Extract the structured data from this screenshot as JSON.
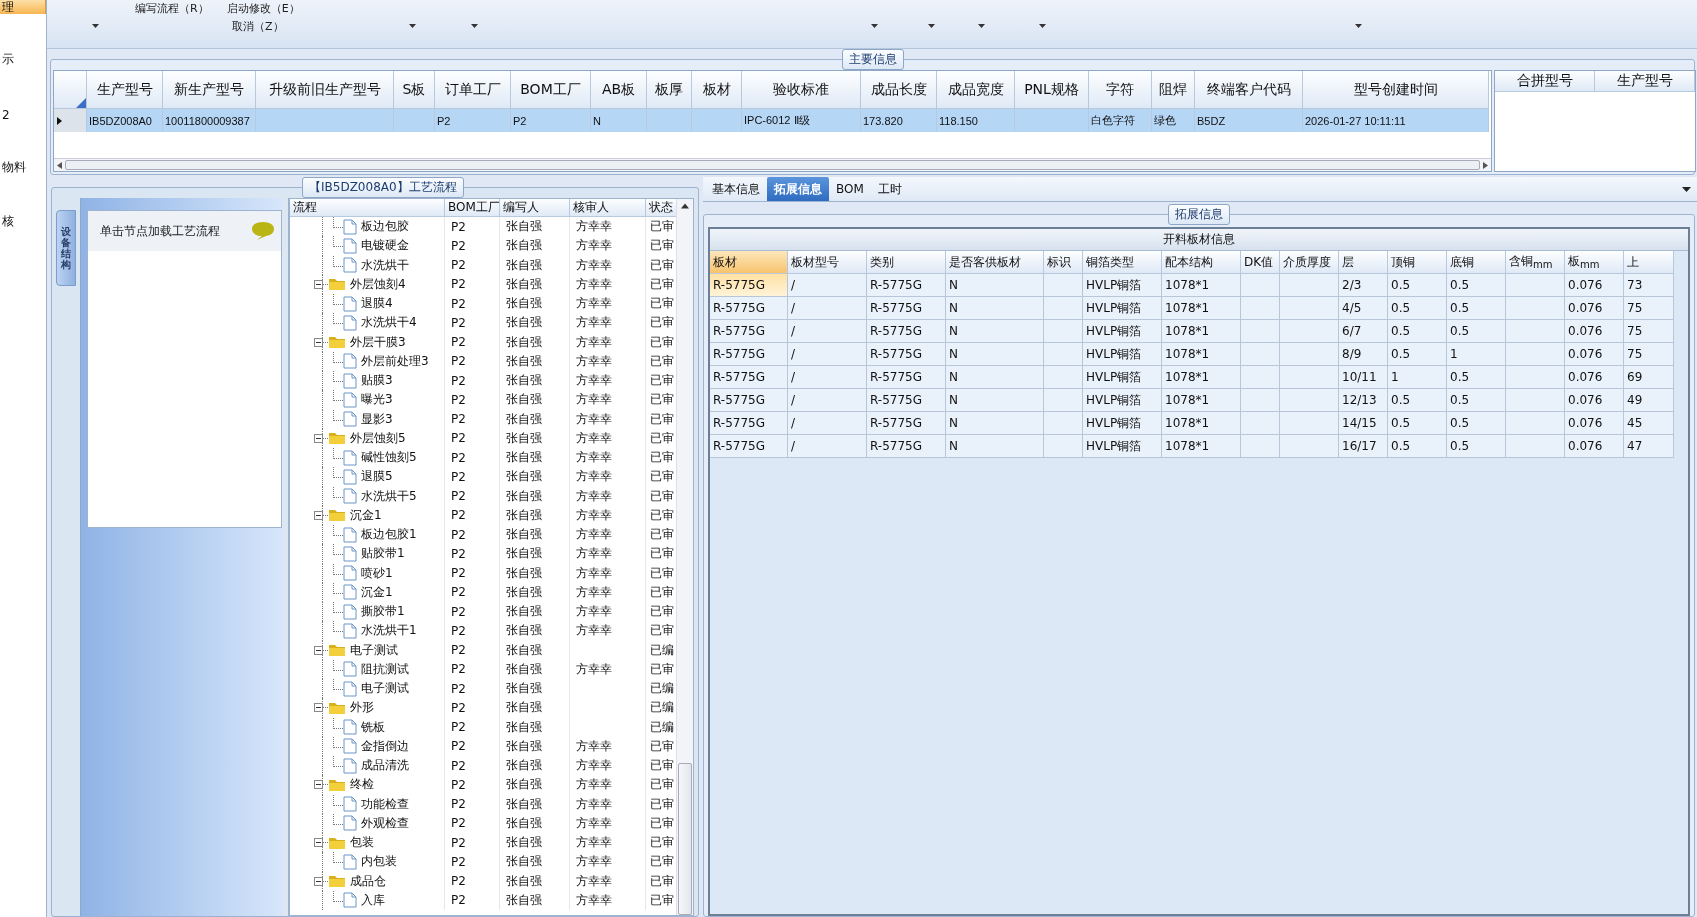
{
  "side_menu": [
    {
      "label": "理",
      "selected": true
    },
    {
      "label": "示",
      "selected": false
    },
    {
      "label": "2",
      "selected": false
    },
    {
      "label": "物料",
      "selected": false
    },
    {
      "label": "核",
      "selected": false
    }
  ],
  "toolbar": {
    "buttons": [
      "编写流程（R）",
      "启动修改（E）"
    ],
    "cancel": "取消（Z）"
  },
  "main_info": {
    "title": "主要信息",
    "columns": [
      "生产型号",
      "新生产型号",
      "升级前旧生产型号",
      "S板",
      "订单工厂",
      "BOM工厂",
      "AB板",
      "板厚",
      "板材",
      "验收标准",
      "成品长度",
      "成品宽度",
      "PNL规格",
      "字符",
      "阻焊",
      "终端客户代码",
      "型号创建时间"
    ],
    "rows": [
      {
        "selected": true,
        "cells": [
          "IB5DZ008A0",
          "10011800009387",
          null,
          null,
          "P2",
          "P2",
          "N",
          null,
          null,
          "IPC-6012 Ⅱ级",
          "173.820",
          "118.150",
          null,
          "白色字符",
          "绿色",
          "B5DZ",
          "2026-01-27 10:11:11"
        ]
      }
    ],
    "merge_table": {
      "columns": [
        "合拼型号",
        "生产型号"
      ]
    }
  },
  "process": {
    "title": "【IB5DZ008A0】工艺流程",
    "side_tab": "设备结构",
    "hint": "单击节点加载工艺流程",
    "tree": {
      "columns": [
        "流程",
        "BOM工厂",
        "编写人",
        "核审人",
        "状态"
      ],
      "continued": [
        {
          "label": "板边包胶",
          "bom": "P2",
          "author": "张自强",
          "reviewer": "方幸幸",
          "status": "已审"
        },
        {
          "label": "电镀硬金",
          "bom": "P2",
          "author": "张自强",
          "reviewer": "方幸幸",
          "status": "已审"
        },
        {
          "label": "水洗烘干",
          "bom": "P2",
          "author": "张自强",
          "reviewer": "方幸幸",
          "status": "已审"
        }
      ],
      "nodes": [
        {
          "label": "外层蚀刻4",
          "bom": "P2",
          "author": "张自强",
          "reviewer": "方幸幸",
          "status": "已审",
          "expanded": true,
          "children": [
            {
              "label": "退膜4",
              "bom": "P2",
              "author": "张自强",
              "reviewer": "方幸幸",
              "status": "已审"
            },
            {
              "label": "水洗烘干4",
              "bom": "P2",
              "author": "张自强",
              "reviewer": "方幸幸",
              "status": "已审"
            }
          ]
        },
        {
          "label": "外层干膜3",
          "bom": "P2",
          "author": "张自强",
          "reviewer": "方幸幸",
          "status": "已审",
          "expanded": true,
          "children": [
            {
              "label": "外层前处理3",
              "bom": "P2",
              "author": "张自强",
              "reviewer": "方幸幸",
              "status": "已审"
            },
            {
              "label": "贴膜3",
              "bom": "P2",
              "author": "张自强",
              "reviewer": "方幸幸",
              "status": "已审"
            },
            {
              "label": "曝光3",
              "bom": "P2",
              "author": "张自强",
              "reviewer": "方幸幸",
              "status": "已审"
            },
            {
              "label": "显影3",
              "bom": "P2",
              "author": "张自强",
              "reviewer": "方幸幸",
              "status": "已审"
            }
          ]
        },
        {
          "label": "外层蚀刻5",
          "bom": "P2",
          "author": "张自强",
          "reviewer": "方幸幸",
          "status": "已审",
          "expanded": true,
          "children": [
            {
              "label": "碱性蚀刻5",
              "bom": "P2",
              "author": "张自强",
              "reviewer": "方幸幸",
              "status": "已审"
            },
            {
              "label": "退膜5",
              "bom": "P2",
              "author": "张自强",
              "reviewer": "方幸幸",
              "status": "已审"
            },
            {
              "label": "水洗烘干5",
              "bom": "P2",
              "author": "张自强",
              "reviewer": "方幸幸",
              "status": "已审"
            }
          ]
        },
        {
          "label": "沉金1",
          "bom": "P2",
          "author": "张自强",
          "reviewer": "方幸幸",
          "status": "已审",
          "expanded": true,
          "children": [
            {
              "label": "板边包胶1",
              "bom": "P2",
              "author": "张自强",
              "reviewer": "方幸幸",
              "status": "已审"
            },
            {
              "label": "贴胶带1",
              "bom": "P2",
              "author": "张自强",
              "reviewer": "方幸幸",
              "status": "已审"
            },
            {
              "label": "喷砂1",
              "bom": "P2",
              "author": "张自强",
              "reviewer": "方幸幸",
              "status": "已审"
            },
            {
              "label": "沉金1",
              "bom": "P2",
              "author": "张自强",
              "reviewer": "方幸幸",
              "status": "已审"
            },
            {
              "label": "撕胶带1",
              "bom": "P2",
              "author": "张自强",
              "reviewer": "方幸幸",
              "status": "已审"
            },
            {
              "label": "水洗烘干1",
              "bom": "P2",
              "author": "张自强",
              "reviewer": "方幸幸",
              "status": "已审"
            }
          ]
        },
        {
          "label": "电子测试",
          "bom": "P2",
          "author": "张自强",
          "status": "已编",
          "expanded": true,
          "children": [
            {
              "label": "阻抗测试",
              "bom": "P2",
              "author": "张自强",
              "reviewer": "方幸幸",
              "status": "已审"
            },
            {
              "label": "电子测试",
              "bom": "P2",
              "author": "张自强",
              "status": "已编"
            }
          ]
        },
        {
          "label": "外形",
          "bom": "P2",
          "author": "张自强",
          "status": "已编",
          "expanded": true,
          "children": [
            {
              "label": "铣板",
              "bom": "P2",
              "author": "张自强",
              "status": "已编"
            },
            {
              "label": "金指倒边",
              "bom": "P2",
              "author": "张自强",
              "reviewer": "方幸幸",
              "status": "已审"
            },
            {
              "label": "成品清洗",
              "bom": "P2",
              "author": "张自强",
              "reviewer": "方幸幸",
              "status": "已审"
            }
          ]
        },
        {
          "label": "终检",
          "bom": "P2",
          "author": "张自强",
          "reviewer": "方幸幸",
          "status": "已审",
          "expanded": true,
          "children": [
            {
              "label": "功能检查",
              "bom": "P2",
              "author": "张自强",
              "reviewer": "方幸幸",
              "status": "已审"
            },
            {
              "label": "外观检查",
              "bom": "P2",
              "author": "张自强",
              "reviewer": "方幸幸",
              "status": "已审"
            }
          ]
        },
        {
          "label": "包装",
          "bom": "P2",
          "author": "张自强",
          "reviewer": "方幸幸",
          "status": "已审",
          "expanded": true,
          "children": [
            {
              "label": "内包装",
              "bom": "P2",
              "author": "张自强",
              "reviewer": "方幸幸",
              "status": "已审"
            }
          ]
        },
        {
          "label": "成品仓",
          "bom": "P2",
          "author": "张自强",
          "reviewer": "方幸幸",
          "status": "已审",
          "expanded": true,
          "children": [
            {
              "label": "入库",
              "bom": "P2",
              "author": "张自强",
              "reviewer": "方幸幸",
              "status": "已审"
            }
          ]
        }
      ]
    }
  },
  "detail": {
    "tabs": [
      {
        "label": "基本信息",
        "selected": false
      },
      {
        "label": "拓展信息",
        "selected": true
      },
      {
        "label": "BOM",
        "selected": false
      },
      {
        "label": "工时",
        "selected": false
      }
    ],
    "group_title": "拓展信息",
    "table": {
      "title": "开料板材信息",
      "columns": [
        {
          "label": "板材",
          "selected": true
        },
        {
          "label": "板材型号",
          "selected": false
        },
        {
          "label": "类别",
          "selected": false
        },
        {
          "label": "是否客供板材",
          "selected": false
        },
        {
          "label": "标识",
          "selected": false
        },
        {
          "label": "铜箔类型",
          "selected": false
        },
        {
          "label": "配本结构",
          "selected": false
        },
        {
          "label": "DK值",
          "selected": false
        },
        {
          "label": "介质厚度",
          "selected": false
        },
        {
          "label": "层",
          "selected": false
        },
        {
          "label": "顶铜",
          "selected": false
        },
        {
          "label": "底铜",
          "selected": false
        },
        {
          "label": "含铜$_{mm}$",
          "selected": false
        },
        {
          "label": "板$_{mm}$",
          "selected": false
        },
        {
          "label": "上",
          "selected": false
        }
      ],
      "rows": [
        {
          "selected": true,
          "cells": [
            "R-5775G",
            "/",
            "R-5775G",
            "N",
            null,
            "HVLP铜箔",
            "1078*1",
            null,
            null,
            "2/3",
            "0.5",
            "0.5",
            null,
            "0.076",
            "73"
          ]
        },
        {
          "selected": false,
          "cells": [
            "R-5775G",
            "/",
            "R-5775G",
            "N",
            null,
            "HVLP铜箔",
            "1078*1",
            null,
            null,
            "4/5",
            "0.5",
            "0.5",
            null,
            "0.076",
            "75"
          ]
        },
        {
          "selected": false,
          "cells": [
            "R-5775G",
            "/",
            "R-5775G",
            "N",
            null,
            "HVLP铜箔",
            "1078*1",
            null,
            null,
            "6/7",
            "0.5",
            "0.5",
            null,
            "0.076",
            "75"
          ]
        },
        {
          "selected": false,
          "cells": [
            "R-5775G",
            "/",
            "R-5775G",
            "N",
            null,
            "HVLP铜箔",
            "1078*1",
            null,
            null,
            "8/9",
            "0.5",
            "1",
            null,
            "0.076",
            "75"
          ]
        },
        {
          "selected": false,
          "cells": [
            "R-5775G",
            "/",
            "R-5775G",
            "N",
            null,
            "HVLP铜箔",
            "1078*1",
            null,
            null,
            "10/11",
            "1",
            "0.5",
            null,
            "0.076",
            "69"
          ]
        },
        {
          "selected": false,
          "cells": [
            "R-5775G",
            "/",
            "R-5775G",
            "N",
            null,
            "HVLP铜箔",
            "1078*1",
            null,
            null,
            "12/13",
            "0.5",
            "0.5",
            null,
            "0.076",
            "49"
          ]
        },
        {
          "selected": false,
          "cells": [
            "R-5775G",
            "/",
            "R-5775G",
            "N",
            null,
            "HVLP铜箔",
            "1078*1",
            null,
            null,
            "14/15",
            "0.5",
            "0.5",
            null,
            "0.076",
            "45"
          ]
        },
        {
          "selected": false,
          "cells": [
            "R-5775G",
            "/",
            "R-5775G",
            "N",
            null,
            "HVLP铜箔",
            "1078*1",
            null,
            null,
            "16/17",
            "0.5",
            "0.5",
            null,
            "0.076",
            "47"
          ]
        }
      ]
    }
  }
}
